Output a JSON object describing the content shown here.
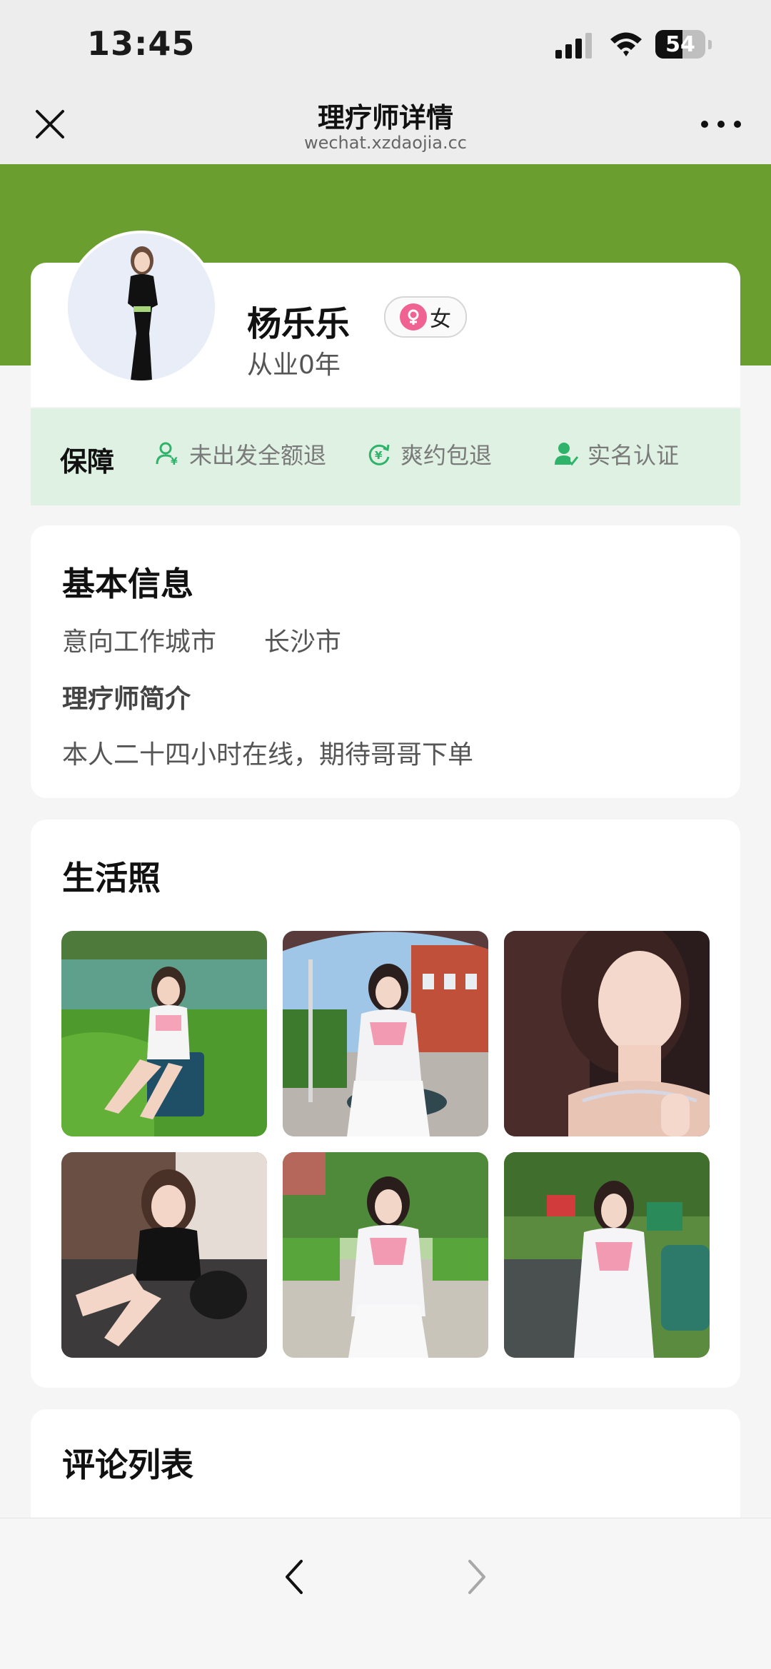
{
  "status_bar": {
    "time": "13:45",
    "battery_level": "54",
    "battery_fraction": 0.54
  },
  "nav": {
    "title": "理疗师详情",
    "subtitle": "wechat.xzdaojia.cc"
  },
  "colors": {
    "brand_green": "#6a9e2e",
    "guarantee_bg": "#dff1e2",
    "icon_green": "#2fb36a",
    "female_pink": "#f06292"
  },
  "profile": {
    "name": "杨乐乐",
    "gender": "女",
    "experience": "从业0年"
  },
  "guarantee": {
    "title": "保障",
    "items": [
      {
        "icon": "refund-person-icon",
        "label": "未出发全额退"
      },
      {
        "icon": "refresh-icon",
        "label": "爽约包退"
      },
      {
        "icon": "verified-user-icon",
        "label": "实名认证"
      }
    ]
  },
  "basic_info": {
    "title": "基本信息",
    "city_label": "意向工作城市",
    "city_value": "长沙市",
    "intro_title": "理疗师简介",
    "intro_text": "本人二十四小时在线，期待哥哥下单"
  },
  "life_photos": {
    "title": "生活照",
    "count": 6
  },
  "reviews": {
    "title": "评论列表"
  }
}
